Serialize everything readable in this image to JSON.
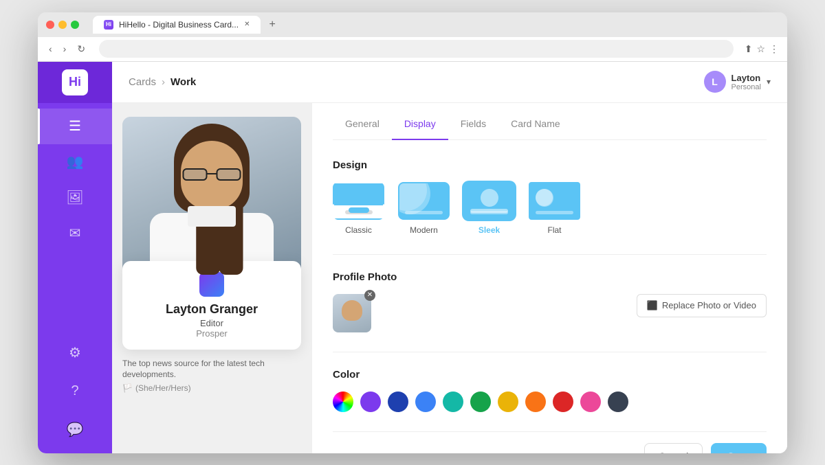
{
  "browser": {
    "tab_title": "HiHello - Digital Business Card...",
    "url": ""
  },
  "breadcrumb": {
    "link": "Cards",
    "separator": "›",
    "current": "Work"
  },
  "user": {
    "name": "Layton",
    "plan": "Personal",
    "avatar_letter": "L"
  },
  "sidebar": {
    "logo": "Hi",
    "items": [
      {
        "id": "cards",
        "icon": "☰",
        "label": "Cards",
        "active": true
      },
      {
        "id": "contacts",
        "icon": "👥",
        "label": "Contacts",
        "active": false
      },
      {
        "id": "gallery",
        "icon": "🖼",
        "label": "Gallery",
        "active": false
      },
      {
        "id": "messages",
        "icon": "✉",
        "label": "Messages",
        "active": false
      }
    ],
    "bottom_items": [
      {
        "id": "settings",
        "icon": "⚙",
        "label": "Settings"
      },
      {
        "id": "help",
        "icon": "?",
        "label": "Help"
      },
      {
        "id": "chat",
        "icon": "💬",
        "label": "Chat"
      }
    ]
  },
  "card_preview": {
    "person_name": "Layton Granger",
    "title": "Editor",
    "company": "Prosper",
    "bio": "The top news source for the latest tech developments.",
    "pronouns": "(She/Her/Hers)"
  },
  "tabs": [
    {
      "id": "general",
      "label": "General",
      "active": false
    },
    {
      "id": "display",
      "label": "Display",
      "active": true
    },
    {
      "id": "fields",
      "label": "Fields",
      "active": false
    },
    {
      "id": "card-name",
      "label": "Card Name",
      "active": false
    }
  ],
  "design": {
    "section_title": "Design",
    "options": [
      {
        "id": "classic",
        "label": "Classic",
        "selected": false
      },
      {
        "id": "modern",
        "label": "Modern",
        "selected": false
      },
      {
        "id": "sleek",
        "label": "Sleek",
        "selected": true
      },
      {
        "id": "flat",
        "label": "Flat",
        "selected": false
      }
    ]
  },
  "profile_photo": {
    "section_title": "Profile Photo",
    "replace_btn_label": "Replace Photo or Video"
  },
  "color": {
    "section_title": "Color",
    "swatches": [
      {
        "id": "rainbow",
        "color": "conic-gradient(red, yellow, lime, cyan, blue, magenta, red)"
      },
      {
        "id": "purple",
        "color": "#7c3aed"
      },
      {
        "id": "navy",
        "color": "#1e40af"
      },
      {
        "id": "blue",
        "color": "#3b82f6"
      },
      {
        "id": "teal",
        "color": "#14b8a6"
      },
      {
        "id": "green",
        "color": "#16a34a"
      },
      {
        "id": "yellow",
        "color": "#eab308"
      },
      {
        "id": "orange",
        "color": "#f97316"
      },
      {
        "id": "red",
        "color": "#dc2626"
      },
      {
        "id": "pink",
        "color": "#ec4899"
      },
      {
        "id": "dark",
        "color": "#374151"
      }
    ]
  },
  "footer": {
    "cancel_label": "Cancel",
    "save_label": "Save"
  }
}
